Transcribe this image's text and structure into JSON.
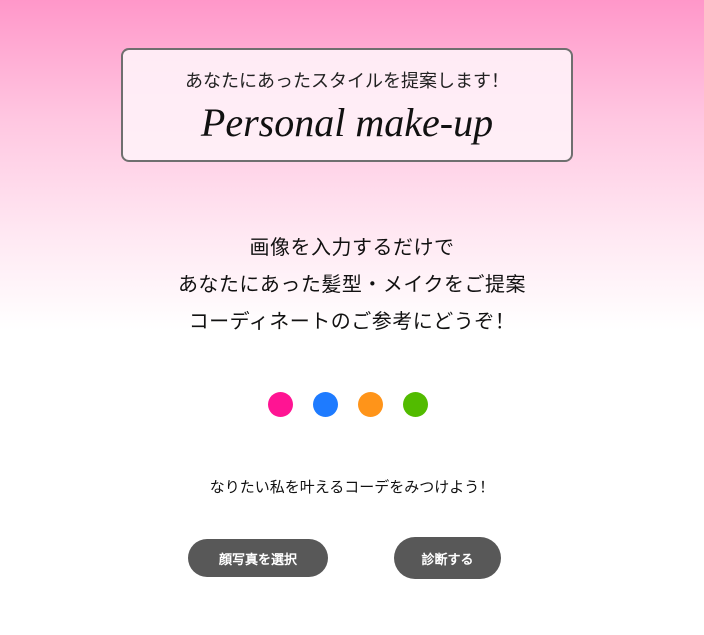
{
  "hero": {
    "subtitle": "あなたにあったスタイルを提案します！",
    "title": "Personal make-up"
  },
  "description": {
    "lines": [
      "画像を入力するだけで",
      "あなたにあった髪型・メイクをご提案",
      "コーディネートのご参考にどうぞ！"
    ]
  },
  "indicators": {
    "colors": [
      "#ff1493",
      "#1e7bff",
      "#ff9419",
      "#52bb00"
    ]
  },
  "prompt": {
    "text": "なりたい私を叶えるコーデをみつけよう！"
  },
  "actions": {
    "select_photo_label": "顔写真を選択",
    "diagnose_label": "診断する"
  },
  "colors": {
    "accent_pink": "#ff97c9",
    "button_background": "#585858",
    "card_border": "#6f6f6f"
  }
}
